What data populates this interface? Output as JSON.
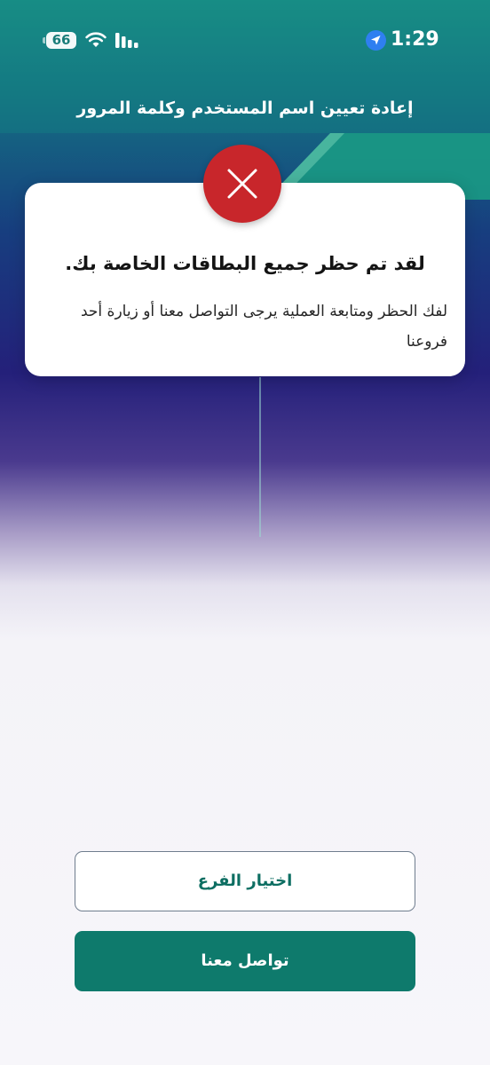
{
  "status_bar": {
    "time": "1:29",
    "battery_level": "66",
    "icons": [
      "location-arrow-icon",
      "wifi-icon",
      "cellular-signal-icon",
      "battery-icon"
    ]
  },
  "header": {
    "title": "إعادة تعيين اسم المستخدم وكلمة المرور"
  },
  "alert": {
    "icon": "error-x-icon",
    "title": "لقد تم حظر جميع البطاقات الخاصة بك.",
    "message": "لفك الحظر ومتابعة العملية يرجى التواصل معنا أو زيارة أحد فروعنا"
  },
  "actions": {
    "choose_branch_label": "اختيار الفرع",
    "contact_us_label": "تواصل معنا"
  },
  "colors": {
    "primary": "#0e7a6c",
    "error": "#c8262b",
    "header_gradient_top": "#1a8f86",
    "header_gradient_mid": "#24207a"
  }
}
